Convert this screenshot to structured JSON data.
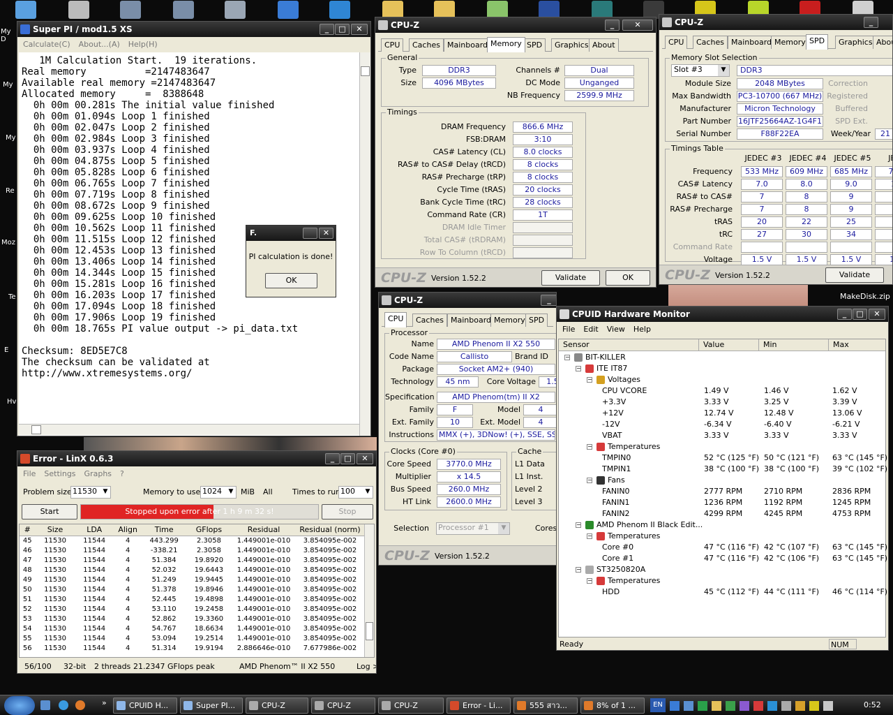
{
  "desktop": {
    "icon_labels_left": [
      "My D",
      "My",
      "My",
      "Re",
      "Moz",
      "Te",
      "E",
      "Hv"
    ],
    "makedisk": "MakeDisk.zip"
  },
  "superpi": {
    "title": "Super PI / mod1.5 XS",
    "menu": [
      "Calculate(C)",
      "About...(A)",
      "Help(H)"
    ],
    "lines": [
      "   1M Calculation Start.  19 iterations.",
      "Real memory          =2147483647",
      "Available real memory =2147483647",
      "Allocated memory     =  8388648",
      "  0h 00m 00.281s The initial value finished",
      "  0h 00m 01.094s Loop 1 finished",
      "  0h 00m 02.047s Loop 2 finished",
      "  0h 00m 02.984s Loop 3 finished",
      "  0h 00m 03.937s Loop 4 finished",
      "  0h 00m 04.875s Loop 5 finished",
      "  0h 00m 05.828s Loop 6 finished",
      "  0h 00m 06.765s Loop 7 finished",
      "  0h 00m 07.719s Loop 8 finished",
      "  0h 00m 08.672s Loop 9 finished",
      "  0h 00m 09.625s Loop 10 finished",
      "  0h 00m 10.562s Loop 11 finished",
      "  0h 00m 11.515s Loop 12 finished",
      "  0h 00m 12.453s Loop 13 finished",
      "  0h 00m 13.406s Loop 14 finished",
      "  0h 00m 14.344s Loop 15 finished",
      "  0h 00m 15.281s Loop 16 finished",
      "  0h 00m 16.203s Loop 17 finished",
      "  0h 00m 17.094s Loop 18 finished",
      "  0h 00m 17.906s Loop 19 finished",
      "  0h 00m 18.765s PI value output -> pi_data.txt",
      "",
      "Checksum: 8ED5E7C8",
      "The checksum can be validated at",
      "http://www.xtremesystems.org/"
    ],
    "dialog": {
      "title": "F.",
      "message": "PI calculation is done!",
      "ok": "OK"
    }
  },
  "cpuz_mem": {
    "title": "CPU-Z",
    "tabs": [
      "CPU",
      "Caches",
      "Mainboard",
      "Memory",
      "SPD",
      "Graphics",
      "About"
    ],
    "active_tab": "Memory",
    "general": "General",
    "type_l": "Type",
    "type": "DDR3",
    "size_l": "Size",
    "size": "4096 MBytes",
    "channels_l": "Channels #",
    "channels": "Dual",
    "dcmode_l": "DC Mode",
    "dcmode": "Unganged",
    "nbfreq_l": "NB Frequency",
    "nbfreq": "2599.9 MHz",
    "timings": "Timings",
    "rows": [
      {
        "l": "DRAM Frequency",
        "v": "866.6 MHz",
        "g": false
      },
      {
        "l": "FSB:DRAM",
        "v": "3:10",
        "g": false
      },
      {
        "l": "CAS# Latency (CL)",
        "v": "8.0 clocks",
        "g": false
      },
      {
        "l": "RAS# to CAS# Delay (tRCD)",
        "v": "8 clocks",
        "g": false
      },
      {
        "l": "RAS# Precharge (tRP)",
        "v": "8 clocks",
        "g": false
      },
      {
        "l": "Cycle Time (tRAS)",
        "v": "20 clocks",
        "g": false
      },
      {
        "l": "Bank Cycle Time (tRC)",
        "v": "28 clocks",
        "g": false
      },
      {
        "l": "Command Rate (CR)",
        "v": "1T",
        "g": false
      },
      {
        "l": "DRAM Idle Timer",
        "v": "",
        "g": true
      },
      {
        "l": "Total CAS# (tRDRAM)",
        "v": "",
        "g": true
      },
      {
        "l": "Row To Column (tRCD)",
        "v": "",
        "g": true
      }
    ],
    "version": "Version 1.52.2",
    "validate": "Validate",
    "ok": "OK",
    "logo": "CPU-Z"
  },
  "cpuz_spd": {
    "title": "CPU-Z",
    "tabs": [
      "CPU",
      "Caches",
      "Mainboard",
      "Memory",
      "SPD",
      "Graphics",
      "About"
    ],
    "active_tab": "SPD",
    "slot_group": "Memory Slot Selection",
    "slot": "Slot #3",
    "type": "DDR3",
    "module_size_l": "Module Size",
    "module_size": "2048 MBytes",
    "max_bw_l": "Max Bandwidth",
    "max_bw": "PC3-10700 (667 MHz)",
    "manuf_l": "Manufacturer",
    "manuf": "Micron Technology",
    "part_l": "Part Number",
    "part": "16JTF25664AZ-1G4F1",
    "serial_l": "Serial Number",
    "serial": "F88F22EA",
    "correction": "Correction",
    "registered": "Registered",
    "buffered": "Buffered",
    "spdext": "SPD Ext.",
    "weekyear_l": "Week/Year",
    "weekyear": "21",
    "table_group": "Timings Table",
    "cols": [
      "JEDEC #3",
      "JEDEC #4",
      "JEDEC #5",
      "JEDE"
    ],
    "trows": [
      {
        "l": "Frequency",
        "v": [
          "533 MHz",
          "609 MHz",
          "685 MHz",
          "761"
        ]
      },
      {
        "l": "CAS# Latency",
        "v": [
          "7.0",
          "8.0",
          "9.0",
          "10"
        ]
      },
      {
        "l": "RAS# to CAS#",
        "v": [
          "7",
          "8",
          "9",
          "1"
        ]
      },
      {
        "l": "RAS# Precharge",
        "v": [
          "7",
          "8",
          "9",
          "1"
        ]
      },
      {
        "l": "tRAS",
        "v": [
          "20",
          "22",
          "25",
          "2"
        ]
      },
      {
        "l": "tRC",
        "v": [
          "27",
          "30",
          "34",
          "3"
        ]
      },
      {
        "l": "Command Rate",
        "v": [
          "",
          "",
          "",
          ""
        ]
      },
      {
        "l": "Voltage",
        "v": [
          "1.5 V",
          "1.5 V",
          "1.5 V",
          "1.5"
        ]
      }
    ],
    "version": "Version 1.52.2",
    "validate": "Validate",
    "logo": "CPU-Z"
  },
  "cpuz_cpu": {
    "title": "CPU-Z",
    "tabs": [
      "CPU",
      "Caches",
      "Mainboard",
      "Memory",
      "SPD"
    ],
    "active_tab": "CPU",
    "processor": "Processor",
    "name_l": "Name",
    "name": "AMD Phenom II X2 550",
    "code_l": "Code Name",
    "code": "Callisto",
    "brand_l": "Brand ID",
    "pkg_l": "Package",
    "pkg": "Socket AM2+ (940)",
    "tech_l": "Technology",
    "tech": "45 nm",
    "cv_l": "Core Voltage",
    "cv": "1.5",
    "spec_l": "Specification",
    "spec": "AMD Phenom(tm) II X2",
    "fam_l": "Family",
    "fam": "F",
    "model_l": "Model",
    "model": "4",
    "efam_l": "Ext. Family",
    "efam": "10",
    "emodel_l": "Ext. Model",
    "emodel": "4",
    "instr_l": "Instructions",
    "instr": "MMX (+), 3DNow! (+), SSE, SSE2, S",
    "clocks": "Clocks (Core #0)",
    "cs_l": "Core Speed",
    "cs": "3770.0 MHz",
    "mult_l": "Multiplier",
    "mult": "x 14.5",
    "bus_l": "Bus Speed",
    "bus": "260.0 MHz",
    "ht_l": "HT Link",
    "ht": "2600.0 MHz",
    "cache": "Cache",
    "l1d": "L1 Data",
    "l1i": "L1 Inst.",
    "l2": "Level 2",
    "l3": "Level 3",
    "sel_l": "Selection",
    "sel": "Processor #1",
    "cores_l": "Cores",
    "version": "Version 1.52.2",
    "logo": "CPU-Z"
  },
  "hwmon": {
    "title": "CPUID Hardware Monitor",
    "menu": [
      "File",
      "Edit",
      "View",
      "Help"
    ],
    "cols": [
      "Sensor",
      "Value",
      "Min",
      "Max"
    ],
    "rows": [
      {
        "t": "BIT-KILLER",
        "v": "",
        "mi": "",
        "ma": ""
      },
      {
        "t": "ITE IT87",
        "v": "",
        "mi": "",
        "ma": ""
      },
      {
        "t": "Voltages",
        "v": "",
        "mi": "",
        "ma": ""
      },
      {
        "t": "CPU VCORE",
        "v": "1.49 V",
        "mi": "1.46 V",
        "ma": "1.62 V"
      },
      {
        "t": "+3.3V",
        "v": "3.33 V",
        "mi": "3.25 V",
        "ma": "3.39 V"
      },
      {
        "t": "+12V",
        "v": "12.74 V",
        "mi": "12.48 V",
        "ma": "13.06 V"
      },
      {
        "t": "-12V",
        "v": "-6.34 V",
        "mi": "-6.40 V",
        "ma": "-6.21 V"
      },
      {
        "t": "VBAT",
        "v": "3.33 V",
        "mi": "3.33 V",
        "ma": "3.33 V"
      },
      {
        "t": "Temperatures",
        "v": "",
        "mi": "",
        "ma": ""
      },
      {
        "t": "TMPIN0",
        "v": "52 °C  (125 °F)",
        "mi": "50 °C  (121 °F)",
        "ma": "63 °C  (145 °F)"
      },
      {
        "t": "TMPIN1",
        "v": "38 °C  (100 °F)",
        "mi": "38 °C  (100 °F)",
        "ma": "39 °C  (102 °F)"
      },
      {
        "t": "Fans",
        "v": "",
        "mi": "",
        "ma": ""
      },
      {
        "t": "FANIN0",
        "v": "2777 RPM",
        "mi": "2710 RPM",
        "ma": "2836 RPM"
      },
      {
        "t": "FANIN1",
        "v": "1236 RPM",
        "mi": "1192 RPM",
        "ma": "1245 RPM"
      },
      {
        "t": "FANIN2",
        "v": "4299 RPM",
        "mi": "4245 RPM",
        "ma": "4753 RPM"
      },
      {
        "t": "AMD Phenom II Black Edit...",
        "v": "",
        "mi": "",
        "ma": ""
      },
      {
        "t": "Temperatures",
        "v": "",
        "mi": "",
        "ma": ""
      },
      {
        "t": "Core #0",
        "v": "47 °C  (116 °F)",
        "mi": "42 °C  (107 °F)",
        "ma": "63 °C  (145 °F)"
      },
      {
        "t": "Core #1",
        "v": "47 °C  (116 °F)",
        "mi": "42 °C  (106 °F)",
        "ma": "63 °C  (145 °F)"
      },
      {
        "t": "ST3250820A",
        "v": "",
        "mi": "",
        "ma": ""
      },
      {
        "t": "Temperatures",
        "v": "",
        "mi": "",
        "ma": ""
      },
      {
        "t": "HDD",
        "v": "45 °C  (112 °F)",
        "mi": "44 °C  (111 °F)",
        "ma": "46 °C  (114 °F)"
      }
    ],
    "status": "Ready",
    "num": "NUM"
  },
  "linx": {
    "title": "Error - LinX 0.6.3",
    "menu": [
      "File",
      "Settings",
      "Graphs",
      "?"
    ],
    "problem_l": "Problem size:",
    "problem": "11530",
    "memory_l": "Memory to use:",
    "memory": "1024",
    "mib": "MiB",
    "all": "All",
    "times_l": "Times to run:",
    "times": "100",
    "start": "Start",
    "stop": "Stop",
    "status": "Stopped upon error after 1 h 9 m 32 s!",
    "status_progress": 0.56,
    "cols": [
      "#",
      "Size",
      "LDA",
      "Align",
      "Time",
      "GFlops",
      "Residual",
      "Residual (norm)"
    ],
    "rows": [
      [
        "45",
        "11530",
        "11544",
        "4",
        "443.299",
        "2.3058",
        "1.449001e-010",
        "3.854095e-002"
      ],
      [
        "46",
        "11530",
        "11544",
        "4",
        "-338.21",
        "2.3058",
        "1.449001e-010",
        "3.854095e-002"
      ],
      [
        "47",
        "11530",
        "11544",
        "4",
        "51.384",
        "19.8920",
        "1.449001e-010",
        "3.854095e-002"
      ],
      [
        "48",
        "11530",
        "11544",
        "4",
        "52.032",
        "19.6443",
        "1.449001e-010",
        "3.854095e-002"
      ],
      [
        "49",
        "11530",
        "11544",
        "4",
        "51.249",
        "19.9445",
        "1.449001e-010",
        "3.854095e-002"
      ],
      [
        "50",
        "11530",
        "11544",
        "4",
        "51.378",
        "19.8946",
        "1.449001e-010",
        "3.854095e-002"
      ],
      [
        "51",
        "11530",
        "11544",
        "4",
        "52.445",
        "19.4898",
        "1.449001e-010",
        "3.854095e-002"
      ],
      [
        "52",
        "11530",
        "11544",
        "4",
        "53.110",
        "19.2458",
        "1.449001e-010",
        "3.854095e-002"
      ],
      [
        "53",
        "11530",
        "11544",
        "4",
        "52.862",
        "19.3360",
        "1.449001e-010",
        "3.854095e-002"
      ],
      [
        "54",
        "11530",
        "11544",
        "4",
        "54.767",
        "18.6634",
        "1.449001e-010",
        "3.854095e-002"
      ],
      [
        "55",
        "11530",
        "11544",
        "4",
        "53.094",
        "19.2514",
        "1.449001e-010",
        "3.854095e-002"
      ],
      [
        "56",
        "11530",
        "11544",
        "4",
        "51.314",
        "19.9194",
        "2.886646e-010",
        "7.677986e-002"
      ]
    ],
    "foot": [
      "56/100",
      "32-bit",
      "2 threads",
      "21.2347 GFlops peak",
      "AMD Phenom™ II X2 550",
      "Log >"
    ]
  },
  "taskbar": {
    "items": [
      "CPUID H...",
      "Super PI...",
      "CPU-Z",
      "CPU-Z",
      "CPU-Z",
      "Error - Li...",
      "555 สาว...",
      "8% of 1 ..."
    ],
    "lang": "EN",
    "clock": "0:52"
  }
}
